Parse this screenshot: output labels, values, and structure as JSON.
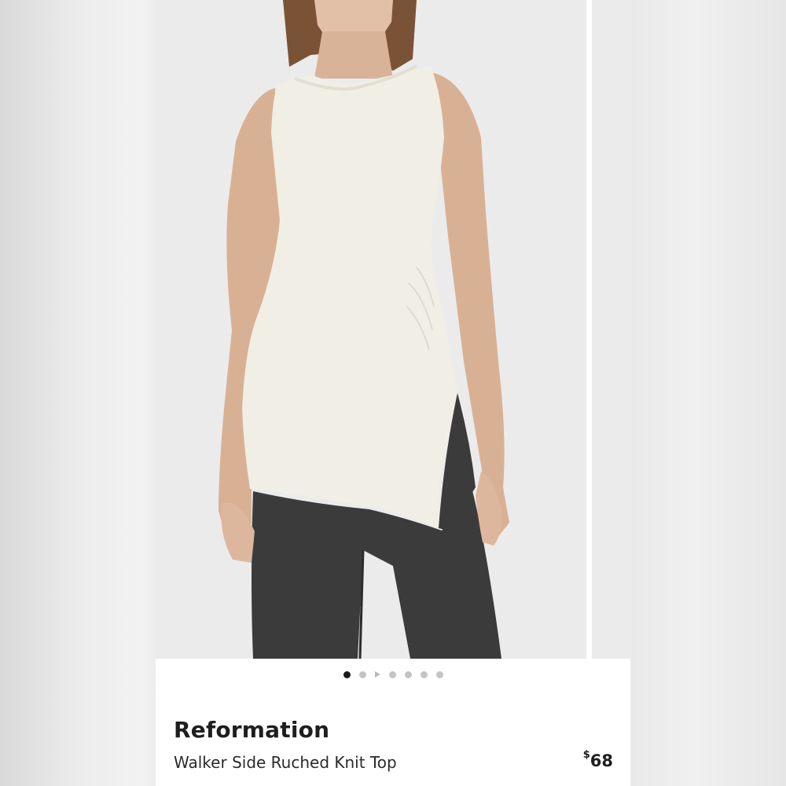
{
  "product": {
    "brand": "Reformation",
    "name": "Walker Side Ruched Knit Top",
    "price_currency": "$",
    "price_amount": "68"
  },
  "carousel": {
    "total_dots": 7,
    "active_index": 0,
    "video_indicator_index": 2
  },
  "colors": {
    "background": "#ebebec",
    "active_dot": "#1b1b1b",
    "inactive_dot": "#c4c4c4",
    "top_fabric": "#f1eee6",
    "jeans": "#3b3b3c",
    "skin": "#dcb79e"
  }
}
